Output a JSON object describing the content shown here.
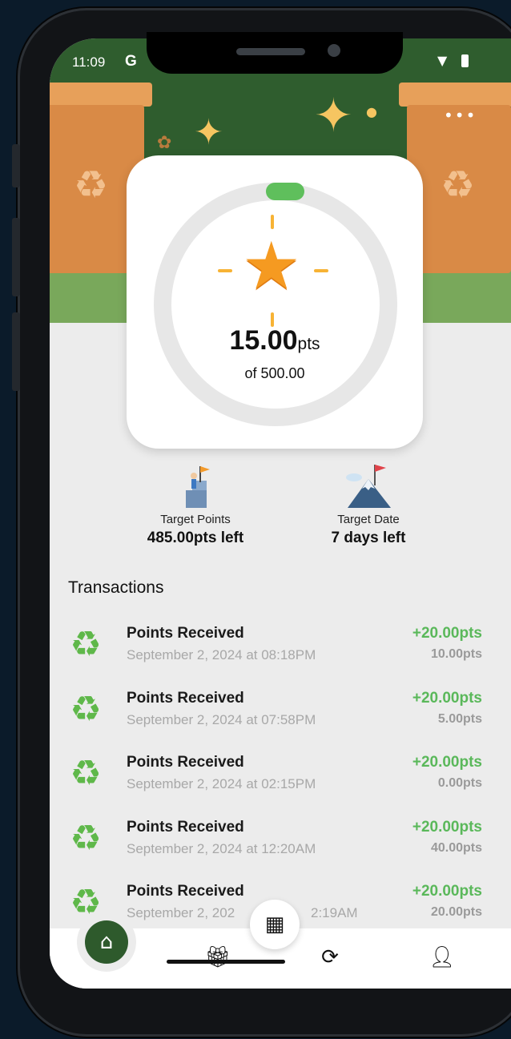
{
  "status_bar": {
    "time": "11:09",
    "g_label": "G"
  },
  "header": {
    "more_label": "•••"
  },
  "points_card": {
    "points": "15.00",
    "unit": "pts",
    "of_label": "of 500.00",
    "progress_fraction": 0.03
  },
  "targets": {
    "points": {
      "label": "Target Points",
      "value": "485.00pts left"
    },
    "date": {
      "label": "Target Date",
      "value": "7 days left"
    }
  },
  "transactions": {
    "title": "Transactions",
    "items": [
      {
        "title": "Points Received",
        "date": "September 2, 2024 at 08:18PM",
        "amount": "+20.00pts",
        "balance": "10.00pts"
      },
      {
        "title": "Points Received",
        "date": "September 2, 2024 at 07:58PM",
        "amount": "+20.00pts",
        "balance": "5.00pts"
      },
      {
        "title": "Points Received",
        "date": "September 2, 2024 at 02:15PM",
        "amount": "+20.00pts",
        "balance": "0.00pts"
      },
      {
        "title": "Points Received",
        "date": "September 2, 2024 at 12:20AM",
        "amount": "+20.00pts",
        "balance": "40.00pts"
      },
      {
        "title": "Points Received",
        "date": "September 2, 202",
        "date_tail": "2:19AM",
        "amount": "+20.00pts",
        "balance": "20.00pts"
      }
    ]
  },
  "nav": {
    "items": [
      "home-icon",
      "gift-icon",
      "qr-scan-icon",
      "recycle-exchange-icon",
      "profile-icon"
    ]
  },
  "colors": {
    "accent_green": "#5ab85a",
    "nav_active": "#2e5a2c",
    "star": "#f59a21",
    "hero_bg": "#2f5d2e"
  }
}
